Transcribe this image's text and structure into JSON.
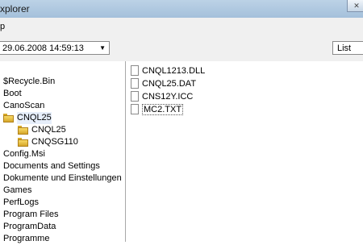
{
  "window": {
    "title": "xplorer",
    "close_glyph": "✕"
  },
  "menu": {
    "items": [
      "p"
    ]
  },
  "toolbar": {
    "date_value": "29.06.2008 14:59:13",
    "view_value": "List",
    "arrow_glyph": "▼"
  },
  "tree": {
    "items": [
      {
        "label": "$Recycle.Bin"
      },
      {
        "label": "Boot"
      },
      {
        "label": "CanoScan"
      },
      {
        "label": "CNQL25"
      },
      {
        "label": "CNQL25"
      },
      {
        "label": "CNQSG110"
      },
      {
        "label": "Config.Msi"
      },
      {
        "label": "Documents and Settings"
      },
      {
        "label": "Dokumente und Einstellungen"
      },
      {
        "label": "Games"
      },
      {
        "label": "PerfLogs"
      },
      {
        "label": "Program Files"
      },
      {
        "label": "ProgramData"
      },
      {
        "label": "Programme"
      }
    ]
  },
  "files": {
    "items": [
      {
        "name": "CNQL1213.DLL",
        "icon": "dll-file-icon"
      },
      {
        "name": "CNQL25.DAT",
        "icon": "dat-file-icon"
      },
      {
        "name": "CNS12Y.ICC",
        "icon": "icc-file-icon"
      },
      {
        "name": "MC2.TXT",
        "icon": "txt-file-icon"
      }
    ]
  }
}
